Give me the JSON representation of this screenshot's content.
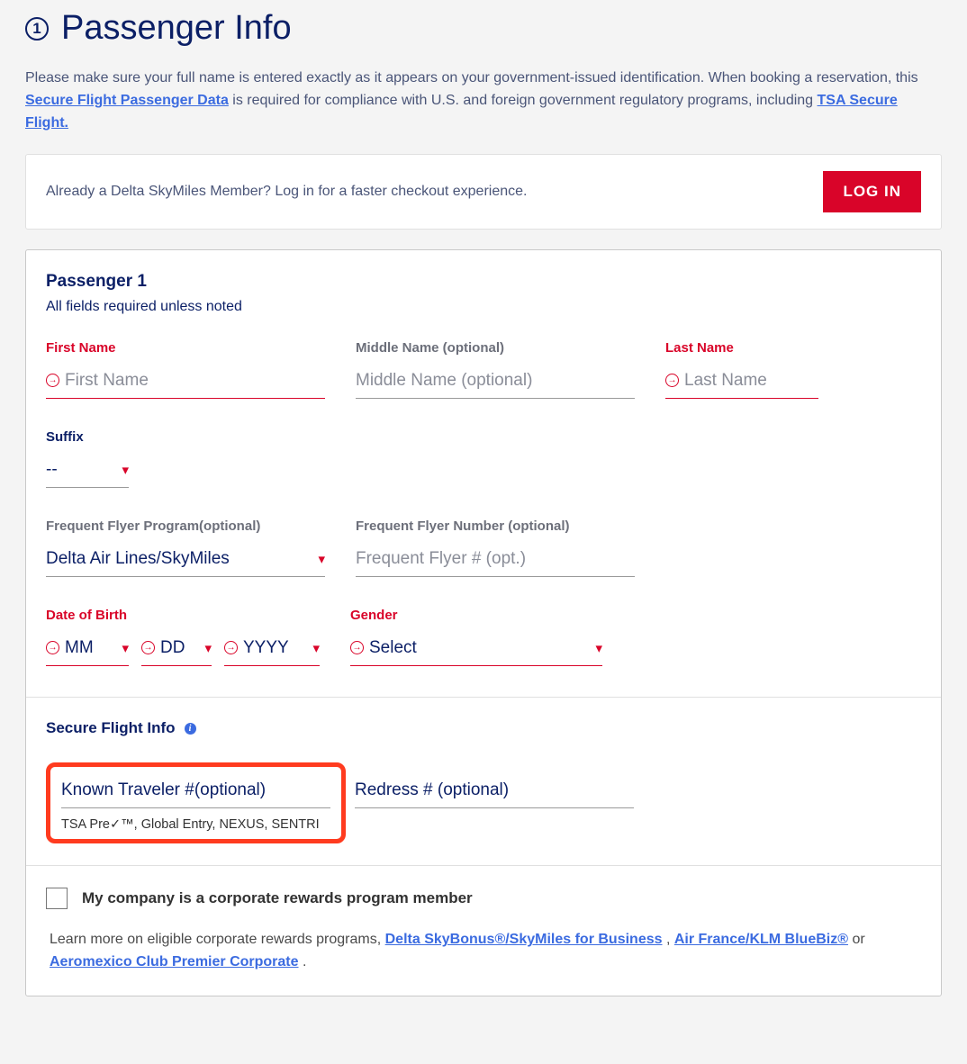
{
  "step_number": "1",
  "page_title": "Passenger Info",
  "intro_pre": "Please make sure your full name is entered exactly as it appears on your government-issued identification. When booking a reservation, this ",
  "intro_link1": "Secure Flight Passenger Data",
  "intro_mid": " is required for compliance with U.S. and foreign government regulatory programs, including ",
  "intro_link2": "TSA Secure Flight.",
  "login_prompt": "Already a Delta SkyMiles Member? Log in for a faster checkout experience.",
  "login_button": "LOG IN",
  "passenger_heading": "Passenger 1",
  "required_note": "All fields required unless noted",
  "labels": {
    "first_name": "First Name",
    "middle_name": "Middle Name (optional)",
    "last_name": "Last Name",
    "suffix": "Suffix",
    "ff_program": "Frequent Flyer Program(optional)",
    "ff_number": "Frequent Flyer Number (optional)",
    "dob": "Date of Birth",
    "gender": "Gender"
  },
  "placeholders": {
    "first_name": "First Name",
    "middle_name": "Middle Name (optional)",
    "last_name": "Last Name",
    "suffix": "--",
    "ff_program": "Delta Air Lines/SkyMiles",
    "ff_number": "Frequent Flyer # (opt.)",
    "mm": "MM",
    "dd": "DD",
    "yyyy": "YYYY",
    "gender": "Select",
    "known_traveler": "Known Traveler #(optional)",
    "redress": "Redress # (optional)"
  },
  "secure_flight_title": "Secure Flight Info",
  "known_traveler_hint": "TSA Pre✓™, Global Entry, NEXUS, SENTRI",
  "corporate_checkbox_label": "My company is a corporate rewards program member",
  "corporate_text_pre": "Learn more on eligible corporate rewards programs, ",
  "corporate_link1": "Delta SkyBonus®/SkyMiles for Business",
  "corporate_sep1": " , ",
  "corporate_link2": "Air France/KLM BlueBiz®",
  "corporate_sep2": "   or ",
  "corporate_link3": "Aeromexico Club Premier Corporate",
  "corporate_text_post": " ."
}
